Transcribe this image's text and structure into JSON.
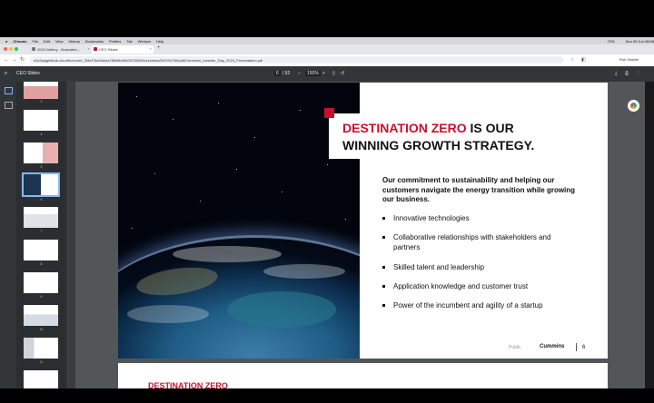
{
  "menubar": {
    "app": "Chrome",
    "items": [
      "File",
      "Edit",
      "View",
      "History",
      "Bookmarks",
      "Profiles",
      "Tab",
      "Window",
      "Help"
    ],
    "battery": "73%",
    "clock": "Sun 09 Jun 08:58"
  },
  "tabs": [
    {
      "label": "2024 Gallery - Illustrated..."
    },
    {
      "label": "CEO Slides"
    }
  ],
  "address": {
    "url": "d3v2ytpgb6sub.cloudfront.net/_2MaT3ia0dd/ca78608b4b9257269f/2/cummins/2b7/94/766/pdf/Cummins_Investor_Day_2024_Presentation.pdf",
    "profile": "Rob Swelek"
  },
  "pdf_toolbar": {
    "title": "CEO Slides",
    "page": "6",
    "page_total": "/ 62",
    "zoom": "150%"
  },
  "thumbnails": {
    "numbers": [
      "3",
      "4",
      "5",
      "6",
      "7",
      "8",
      "9",
      "10",
      "11"
    ]
  },
  "slide": {
    "title_red": "DESTINATION ZERO",
    "title_rest": " IS OUR",
    "title_line2": "WINNING GROWTH STRATEGY.",
    "lead": "Our commitment to sustainability and helping our customers navigate the energy transition while growing our business.",
    "bullets": [
      "Innovative technologies",
      "Collaborative relationships with stakeholders and partners",
      "Skilled talent and leadership",
      "Application knowledge and customer trust",
      "Power of the incumbent and agility of a startup"
    ],
    "footer_public": "Public",
    "footer_logo": "Cummins",
    "page_number": "6"
  },
  "next_slide": {
    "title": "DESTINATION ZERO"
  },
  "colors": {
    "brand_red": "#c8102e",
    "pdf_toolbar": "#323639",
    "viewer_bg": "#525659"
  }
}
